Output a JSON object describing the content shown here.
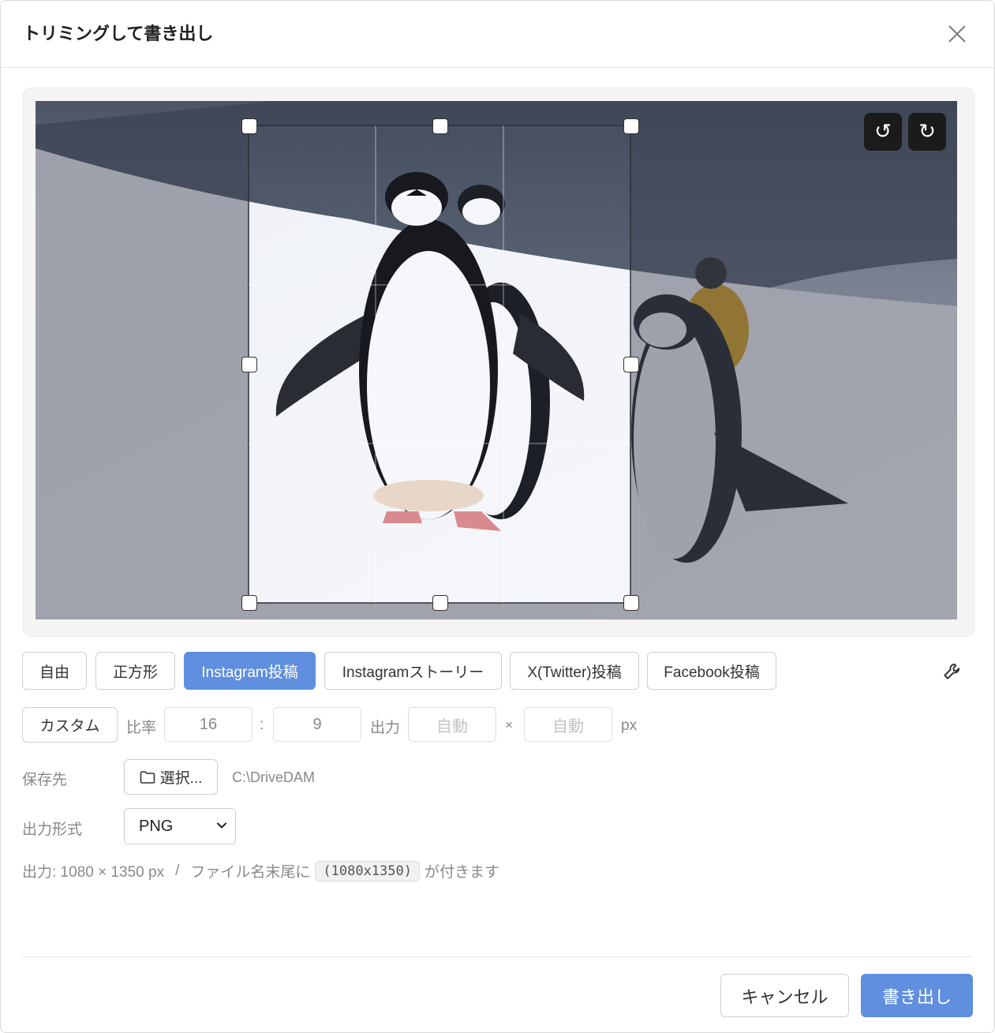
{
  "dialog": {
    "title": "トリミングして書き出し",
    "close_icon": "close-icon"
  },
  "preview": {
    "rotate_ccw_glyph": "↺",
    "rotate_cw_glyph": "↻"
  },
  "presets": {
    "items": [
      {
        "label": "自由",
        "active": false
      },
      {
        "label": "正方形",
        "active": false
      },
      {
        "label": "Instagram投稿",
        "active": true
      },
      {
        "label": "Instagramストーリー",
        "active": false
      },
      {
        "label": "X(Twitter)投稿",
        "active": false
      },
      {
        "label": "Facebook投稿",
        "active": false
      }
    ],
    "settings_icon": "wrench-icon"
  },
  "custom": {
    "button_label": "カスタム",
    "ratio_label": "比率",
    "ratio_w": "16",
    "ratio_sep": ":",
    "ratio_h": "9",
    "output_label": "出力",
    "width_placeholder": "自動",
    "times": "×",
    "height_placeholder": "自動",
    "unit": "px"
  },
  "save": {
    "label": "保存先",
    "choose_button": "選択...",
    "path": "C:\\DriveDAM"
  },
  "format": {
    "label": "出力形式",
    "selected": "PNG"
  },
  "summary": {
    "output_text": "出力: 1080 × 1350 px",
    "slash": "/",
    "suffix_prefix": "ファイル名末尾に",
    "suffix_code": "(1080x1350)",
    "suffix_tail": "が付きます"
  },
  "footer": {
    "cancel_label": "キャンセル",
    "export_label": "書き出し"
  },
  "colors": {
    "accent": "#5f8fde",
    "dark_button": "#1b1b1b"
  }
}
